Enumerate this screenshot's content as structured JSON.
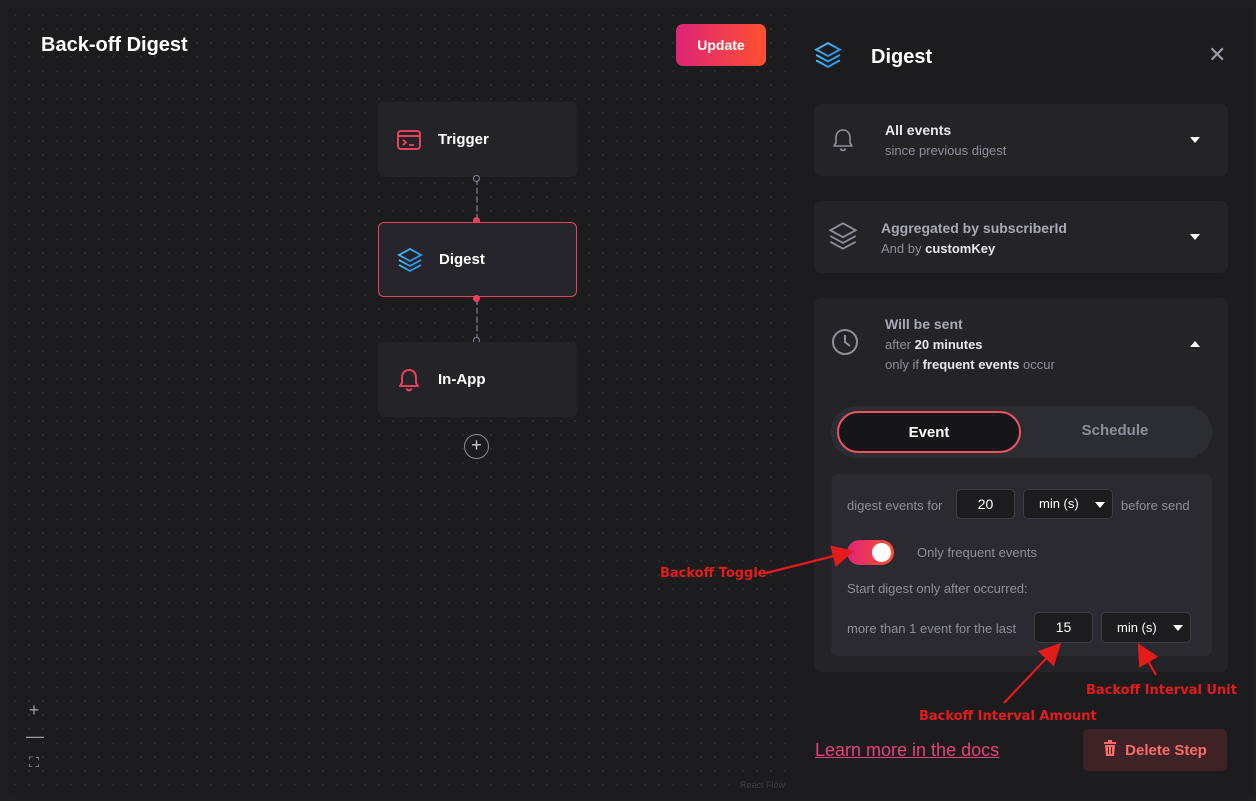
{
  "canvas": {
    "title": "Back-off Digest",
    "update_label": "Update",
    "nodes": [
      {
        "label": "Trigger",
        "icon": "terminal-card-icon"
      },
      {
        "label": "Digest",
        "icon": "layers-icon"
      },
      {
        "label": "In-App",
        "icon": "bell-icon"
      }
    ],
    "add_node_label": "+",
    "controls": {
      "zoom_in": "+",
      "zoom_out": "—",
      "fit": "⛶"
    },
    "attribution": "React Flow"
  },
  "panel": {
    "title": "Digest",
    "close_label": "✕",
    "events_card": {
      "line1": "All events",
      "line2": "since previous digest"
    },
    "aggregate_card": {
      "line1": "Aggregated by subscriberId",
      "line2_prefix": "And by ",
      "line2_key": "customKey"
    },
    "timing_card": {
      "line1": "Will be sent",
      "line2_prefix": "after ",
      "line2_value": "20 minutes",
      "line3_prefix": "only if ",
      "line3_value": "frequent events",
      "line3_suffix": " occur"
    },
    "segment": {
      "event_label": "Event",
      "schedule_label": "Schedule"
    },
    "settings": {
      "digest_for_label": "digest events for",
      "digest_amount": "20",
      "digest_unit": "min (s)",
      "before_send_label": "before send",
      "toggle_label": "Only frequent events",
      "start_digest_label": "Start digest only after occurred:",
      "more_than_label": "more than 1 event for the last",
      "backoff_amount": "15",
      "backoff_unit": "min (s)"
    },
    "learn_more": "Learn more in the docs",
    "delete_label": "Delete Step"
  },
  "annotations": {
    "toggle": "Backoff Toggle",
    "amount": "Backoff Interval Amount",
    "unit": "Backoff Interval Unit"
  },
  "colors": {
    "accent_start": "#dd2476",
    "accent_end": "#ff512f",
    "annotation": "#e41b1b"
  }
}
